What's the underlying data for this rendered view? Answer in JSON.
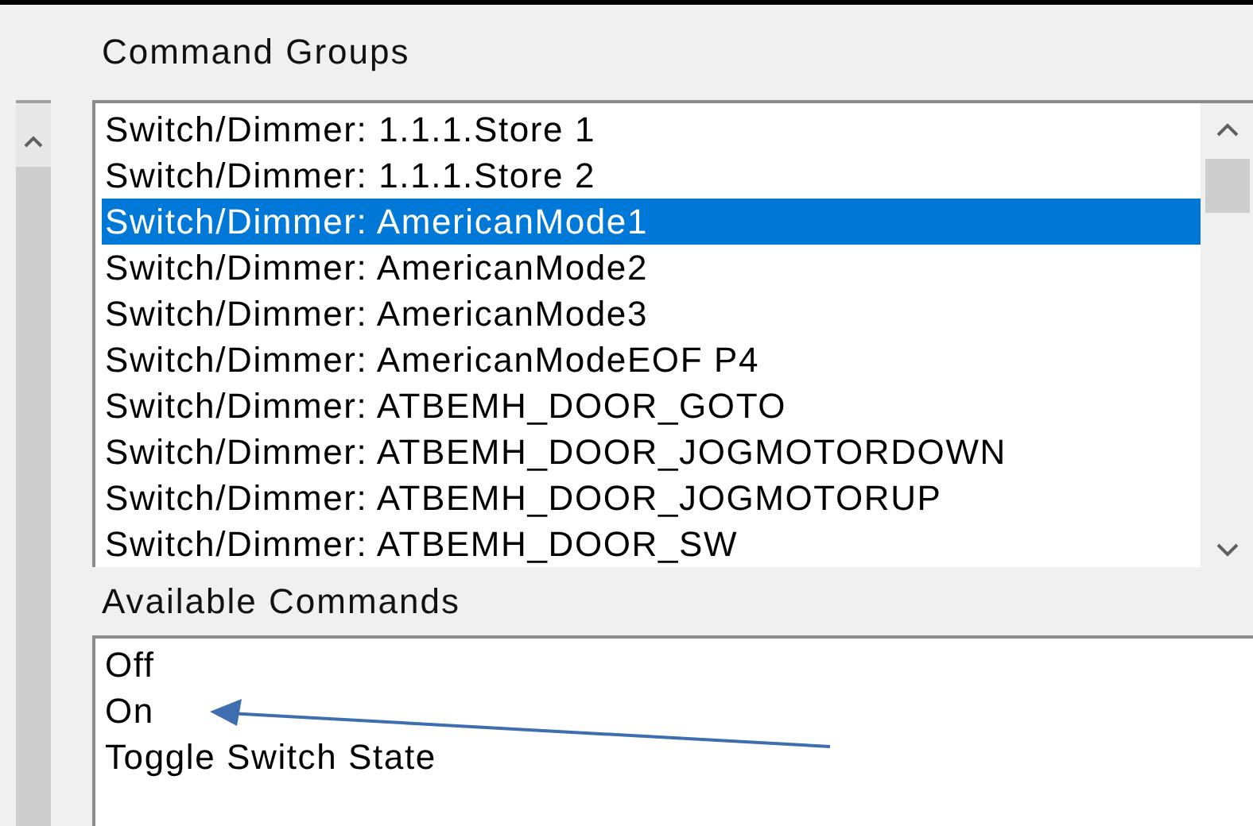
{
  "command_groups": {
    "label": "Command Groups",
    "items": [
      {
        "text": "Switch/Dimmer: 1.1.1.Store 1",
        "selected": false
      },
      {
        "text": "Switch/Dimmer: 1.1.1.Store 2",
        "selected": false
      },
      {
        "text": "Switch/Dimmer: AmericanMode1",
        "selected": true
      },
      {
        "text": "Switch/Dimmer: AmericanMode2",
        "selected": false
      },
      {
        "text": "Switch/Dimmer: AmericanMode3",
        "selected": false
      },
      {
        "text": "Switch/Dimmer: AmericanModeEOF P4",
        "selected": false
      },
      {
        "text": "Switch/Dimmer: ATBEMH_DOOR_GOTO",
        "selected": false
      },
      {
        "text": "Switch/Dimmer: ATBEMH_DOOR_JOGMOTORDOWN",
        "selected": false
      },
      {
        "text": "Switch/Dimmer: ATBEMH_DOOR_JOGMOTORUP",
        "selected": false
      },
      {
        "text": "Switch/Dimmer: ATBEMH_DOOR_SW",
        "selected": false
      }
    ]
  },
  "available_commands": {
    "label": "Available Commands",
    "items": [
      {
        "text": "Off",
        "selected": false
      },
      {
        "text": "On",
        "selected": false
      },
      {
        "text": "Toggle Switch State",
        "selected": false
      }
    ]
  }
}
